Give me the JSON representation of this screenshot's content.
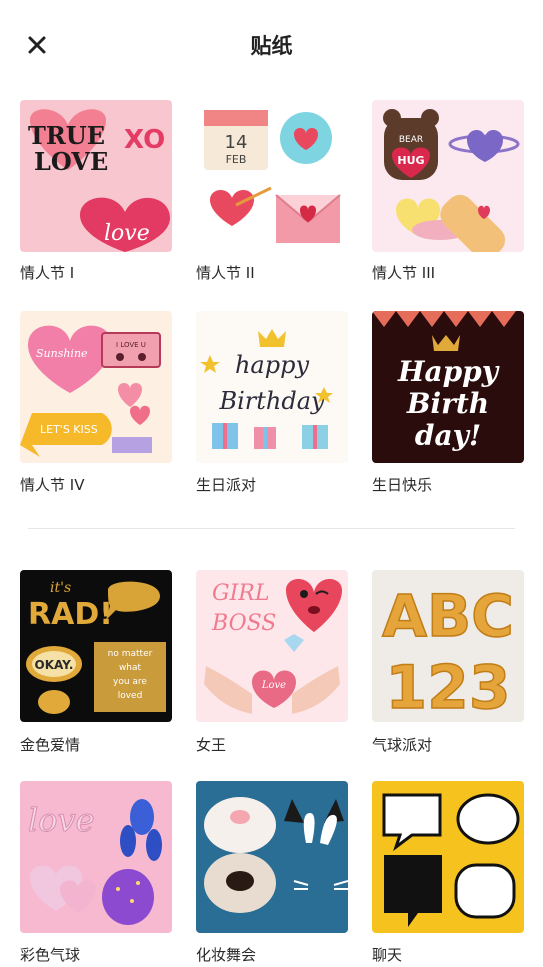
{
  "header": {
    "title": "贴纸",
    "close_icon": "close-icon"
  },
  "sections": [
    {
      "packs": [
        {
          "label": "情人节 I",
          "thumb": "valentine-true-love-stickers"
        },
        {
          "label": "情人节 II",
          "thumb": "valentine-calendar-heart-stickers"
        },
        {
          "label": "情人节 III",
          "thumb": "valentine-bear-hug-stickers"
        },
        {
          "label": "情人节 IV",
          "thumb": "valentine-cassette-lets-kiss-stickers"
        },
        {
          "label": "生日派对",
          "thumb": "happy-birthday-gifts-stickers"
        },
        {
          "label": "生日快乐",
          "thumb": "happy-birthday-day-stickers"
        }
      ]
    },
    {
      "packs": [
        {
          "label": "金色爱情",
          "thumb": "gold-its-rad-okay-stickers"
        },
        {
          "label": "女王",
          "thumb": "girl-boss-stickers"
        },
        {
          "label": "气球派对",
          "thumb": "gold-balloon-letters-abc-123"
        },
        {
          "label": "彩色气球",
          "thumb": "pink-love-balloons"
        },
        {
          "label": "化妆舞会",
          "thumb": "animal-nose-ears-masks"
        },
        {
          "label": "聊天",
          "thumb": "speech-bubble-stickers"
        }
      ]
    }
  ],
  "tile_text": {
    "true_love_1": "TRUE",
    "true_love_2": "LOVE",
    "xo": "XO",
    "love_script": "love",
    "cal_day": "14",
    "cal_month": "FEB",
    "bear_1": "BEAR",
    "bear_2": "HUG",
    "sunshine": "Sunshine",
    "cassette": "I LOVE U",
    "lets_kiss": "LET'S KISS",
    "hb_happy": "happy",
    "hb_birthday": "Birthday",
    "hbd_1": "Happy",
    "hbd_2": "Birth",
    "hbd_3": "day!",
    "rad_1": "it's",
    "rad_2": "RAD!",
    "okay": "OKAY.",
    "no_matter_1": "no matter",
    "no_matter_2": "what",
    "no_matter_3": "you are",
    "no_matter_4": "loved",
    "girl": "GIRL",
    "boss": "BOSS",
    "love_heart": "Love",
    "abc": "ABC",
    "n123": "123",
    "love_balloon": "love"
  },
  "colors": {
    "pink_bg": "#f8c6cf",
    "gold": "#e0a93a",
    "dark": "#1c0c0c",
    "yellow": "#f6c21d",
    "blue": "#2a6e96"
  }
}
